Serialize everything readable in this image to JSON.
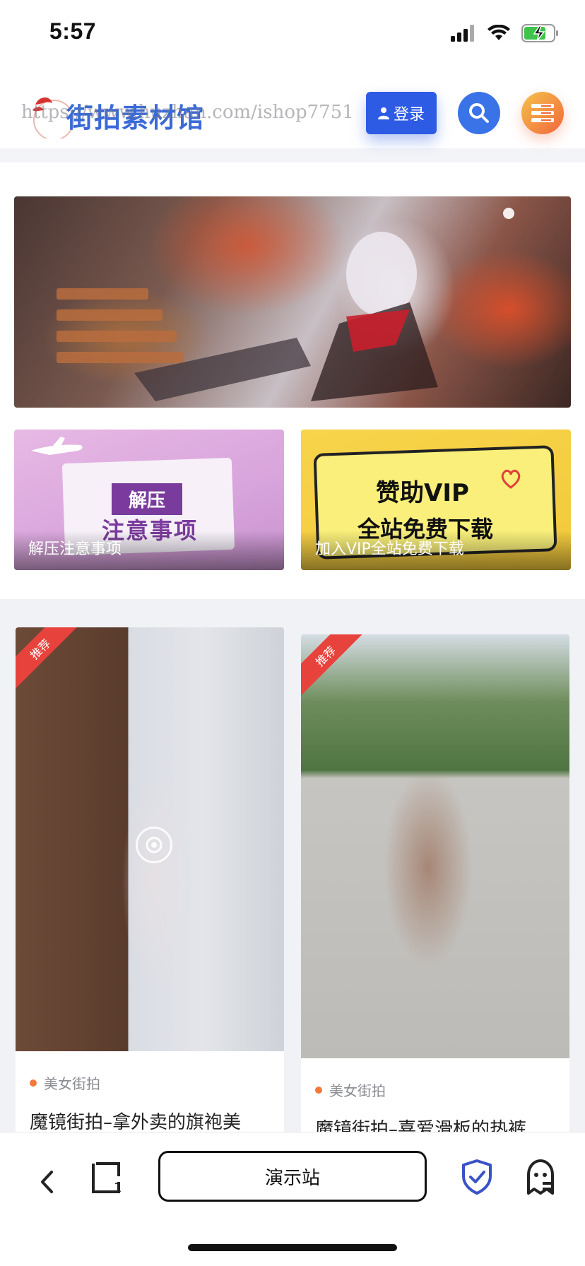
{
  "status_bar": {
    "time": "5:57",
    "icons": [
      "signal-icon",
      "wifi-icon",
      "battery-charging-icon"
    ]
  },
  "header": {
    "logo_text": "街拍素材馆",
    "watermark": "https://www.huzhan.com/ishop7751",
    "login_label": "登录",
    "icons": [
      "user-icon",
      "search-icon",
      "menu-icon"
    ],
    "colors": {
      "login": "#2d5be3",
      "search": "#3a72e8",
      "menu_from": "#f5c24a",
      "menu_to": "#f2663d"
    }
  },
  "promos": [
    {
      "title": "解压注意事项",
      "badge": "解压",
      "headline": "注意事项"
    },
    {
      "title": "加入VIP全站免费下载",
      "headline1": "赞助VIP",
      "headline2": "全站免费下载"
    }
  ],
  "posts": [
    {
      "ribbon": "推荐",
      "category": "美女街拍",
      "title": "魔镜街拍–拿外卖的旗袍美"
    },
    {
      "ribbon": "推荐",
      "category": "美女街拍",
      "title": "魔镜街拍–喜爱滑板的热裤"
    }
  ],
  "bottom_bar": {
    "address": "演示站",
    "icons": [
      "back-icon",
      "tabs-icon",
      "shield-check-icon",
      "ghost-icon"
    ],
    "tab_count": "1"
  }
}
